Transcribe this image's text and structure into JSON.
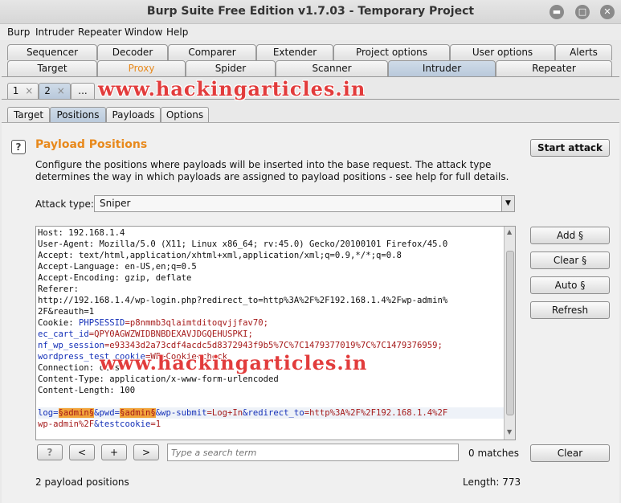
{
  "window": {
    "title": "Burp Suite Free Edition v1.7.03 - Temporary Project",
    "minimize": "▬",
    "maximize": "□",
    "close": "✕"
  },
  "menu": [
    "Burp",
    "Intruder",
    "Repeater",
    "Window",
    "Help"
  ],
  "tabs_row1": [
    "Sequencer",
    "Decoder",
    "Comparer",
    "Extender",
    "Project options",
    "User options",
    "Alerts"
  ],
  "tabs_row2": [
    "Target",
    "Proxy",
    "Spider",
    "Scanner",
    "Intruder",
    "Repeater"
  ],
  "attack_tabs": [
    "1",
    "2",
    "..."
  ],
  "attack_tab_close": "×",
  "sub_tabs": [
    "Target",
    "Positions",
    "Payloads",
    "Options"
  ],
  "watermark": "www.hackingarticles.in",
  "positions": {
    "help_icon": "?",
    "heading": "Payload Positions",
    "description": "Configure the positions where payloads will be inserted into the base request. The attack type determines the way in which payloads are assigned to payload positions - see help for full details.",
    "start_attack": "Start attack",
    "attack_type_label": "Attack type:",
    "attack_type_value": "Sniper",
    "add_button": "Add §",
    "clear_button": "Clear §",
    "auto_button": "Auto §",
    "refresh_button": "Refresh"
  },
  "request": {
    "host": "Host: 192.168.1.4",
    "user_agent": "User-Agent: Mozilla/5.0 (X11; Linux x86_64; rv:45.0) Gecko/20100101 Firefox/45.0",
    "accept": "Accept: text/html,application/xhtml+xml,application/xml;q=0.9,*/*;q=0.8",
    "accept_language": "Accept-Language: en-US,en;q=0.5",
    "accept_encoding": "Accept-Encoding: gzip, deflate",
    "referer": "Referer:",
    "referer_url_1": "http://192.168.1.4/wp-login.php?redirect_to=http%3A%2F%2F192.168.1.4%2Fwp-admin%",
    "referer_url_2": "2F&reauth=1",
    "cookie_label": "Cookie: ",
    "phpsessid_name": "PHPSESSID",
    "phpsessid_value": "=p8nmmb3qlaimtditoqvjjfav70;",
    "eccart_name": "ec_cart_id",
    "eccart_value": "=QPY0AGWZWIDBNBDEXAVJDGQEHUSPKI;",
    "nfwp_name": "nf_wp_session",
    "nfwp_value": "=e93343d2a73cdf4acdc5d8372943f9b5%7C%7C1479377019%7C%7C1479376959;",
    "wptest_name": "wordpress_test_cookie",
    "wptest_value": "=WP+Cookie+check",
    "connection": "Connection: close",
    "content_type": "Content-Type: application/x-www-form-urlencoded",
    "content_length": "Content-Length: 100",
    "body_log_key": "log=",
    "body_log_payload": "§admin§",
    "body_pwd_key": "&pwd=",
    "body_pwd_payload": "§admin§",
    "body_submit_key": "&wp-submit",
    "body_submit_value": "=Log+In",
    "body_redirect_key": "&redirect_to",
    "body_redirect_value": "=http%3A%2F%2F192.168.1.4%2F",
    "body_line2_value": "wp-admin%2F",
    "body_testcookie_key": "&testcookie",
    "body_testcookie_value": "=1"
  },
  "search": {
    "help": "?",
    "prev": "<",
    "add": "+",
    "next": ">",
    "placeholder": "Type a search term",
    "matches": "0 matches",
    "clear": "Clear"
  },
  "footer": {
    "payload_positions": "2 payload positions",
    "length": "Length: 773"
  }
}
